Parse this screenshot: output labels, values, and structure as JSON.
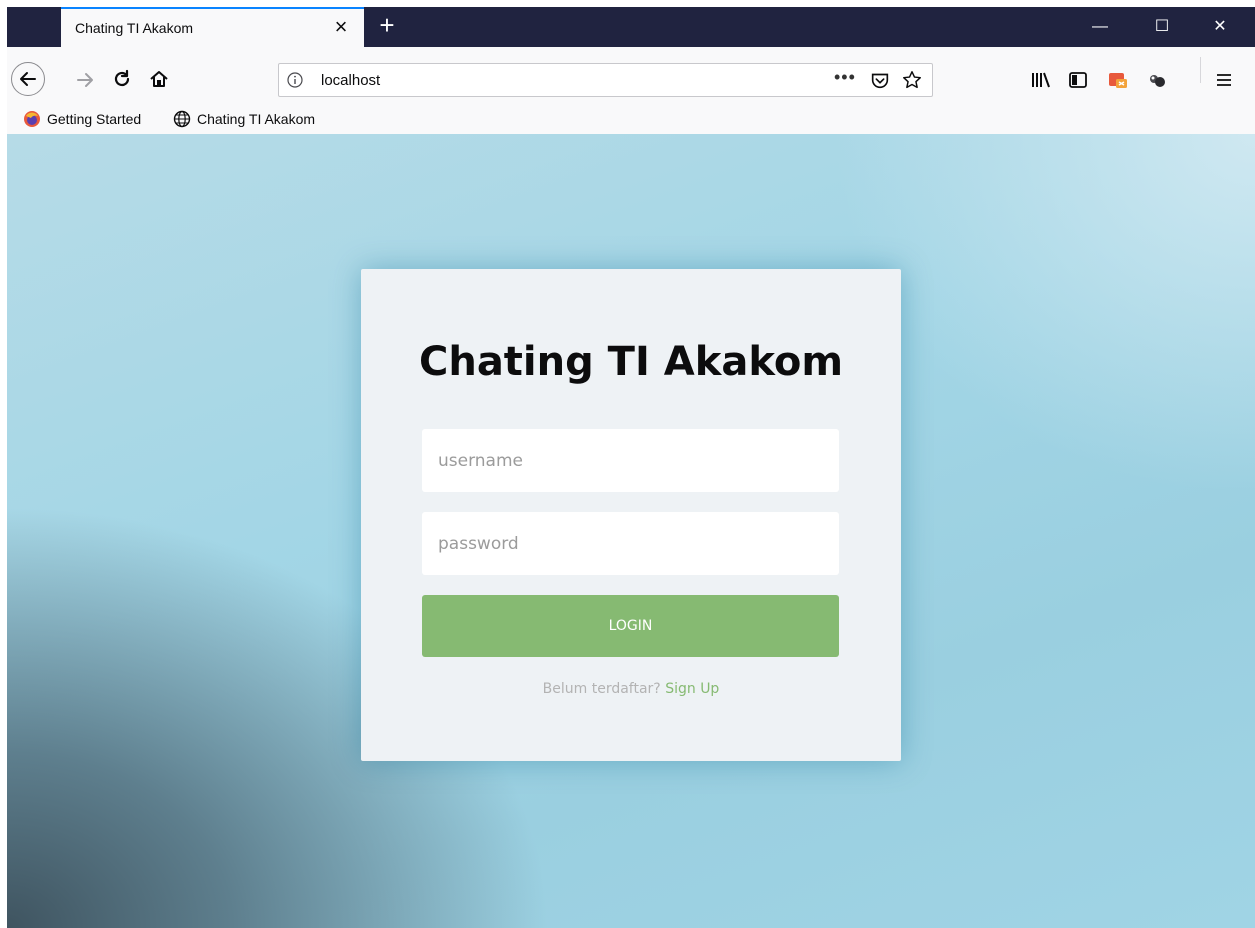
{
  "browser": {
    "tab": {
      "title": "Chating TI Akakom",
      "close": "×"
    },
    "new_tab": "+",
    "window_controls": {
      "minimize": "—",
      "maximize": "☐",
      "close": "✕"
    },
    "url": {
      "value": "localhost",
      "more": "•••"
    },
    "bookmarks": [
      {
        "label": "Getting Started",
        "icon": "firefox-icon"
      },
      {
        "label": "Chating TI Akakom",
        "icon": "globe-icon"
      }
    ]
  },
  "login": {
    "title": "Chating TI Akakom",
    "username_placeholder": "username",
    "password_placeholder": "password",
    "button_label": "LOGIN",
    "signup_prompt": "Belum terdaftar?",
    "signup_link": "Sign Up"
  },
  "colors": {
    "tabbar": "#202340",
    "accent_green": "#86ba72",
    "card_background": "#eef2f5"
  }
}
